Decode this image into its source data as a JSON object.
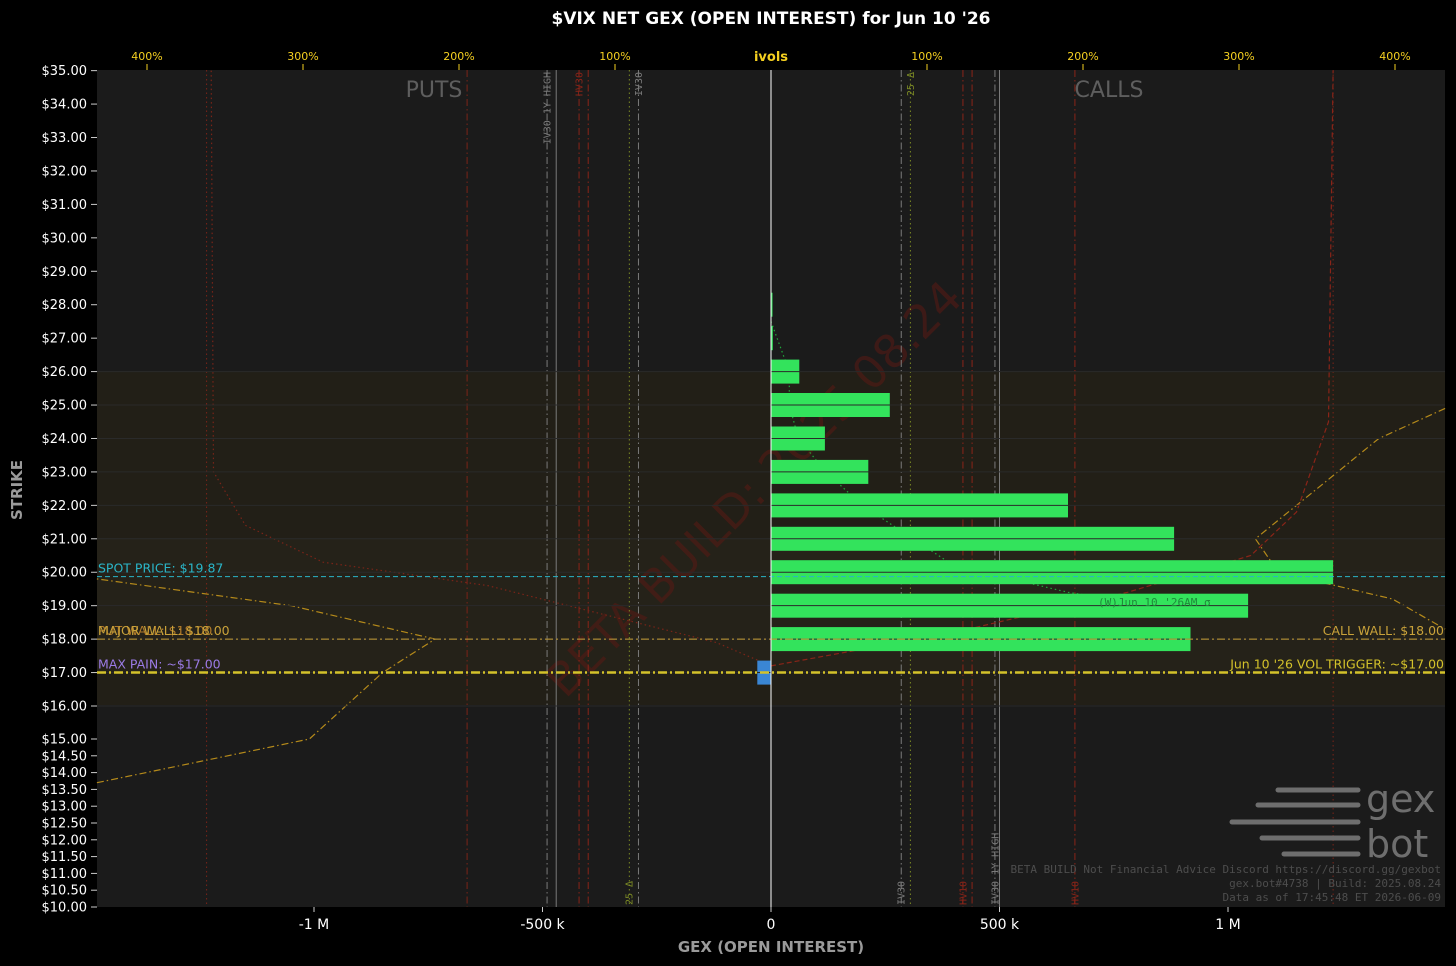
{
  "chart_data": {
    "type": "bar",
    "orientation": "horizontal",
    "title": "$VIX NET GEX (OPEN INTEREST) for Jun 10 '26",
    "xlabel": "GEX (OPEN INTEREST)",
    "ylabel": "STRIKE",
    "x_ticks": [
      {
        "value": -1000000,
        "label": "-1 M"
      },
      {
        "value": -500000,
        "label": "-500 k"
      },
      {
        "value": 0,
        "label": "0"
      },
      {
        "value": 500000,
        "label": "500 k"
      },
      {
        "value": 1000000,
        "label": "1 M"
      }
    ],
    "xlim": [
      -1475000,
      1475000
    ],
    "y_ticks": [
      {
        "value": 35,
        "label": "$35.00"
      },
      {
        "value": 34,
        "label": "$34.00"
      },
      {
        "value": 33,
        "label": "$33.00"
      },
      {
        "value": 32,
        "label": "$32.00"
      },
      {
        "value": 31,
        "label": "$31.00"
      },
      {
        "value": 30,
        "label": "$30.00"
      },
      {
        "value": 29,
        "label": "$29.00"
      },
      {
        "value": 28,
        "label": "$28.00"
      },
      {
        "value": 27,
        "label": "$27.00"
      },
      {
        "value": 26,
        "label": "$26.00"
      },
      {
        "value": 25,
        "label": "$25.00"
      },
      {
        "value": 24,
        "label": "$24.00"
      },
      {
        "value": 23,
        "label": "$23.00"
      },
      {
        "value": 22,
        "label": "$22.00"
      },
      {
        "value": 21,
        "label": "$21.00"
      },
      {
        "value": 20,
        "label": "$20.00"
      },
      {
        "value": 19,
        "label": "$19.00"
      },
      {
        "value": 18,
        "label": "$18.00"
      },
      {
        "value": 17,
        "label": "$17.00"
      },
      {
        "value": 16,
        "label": "$16.00"
      },
      {
        "value": 15,
        "label": "$15.00"
      },
      {
        "value": 14.5,
        "label": "$14.50"
      },
      {
        "value": 14,
        "label": "$14.00"
      },
      {
        "value": 13.5,
        "label": "$13.50"
      },
      {
        "value": 13,
        "label": "$13.00"
      },
      {
        "value": 12.5,
        "label": "$12.50"
      },
      {
        "value": 12,
        "label": "$12.00"
      },
      {
        "value": 11.5,
        "label": "$11.50"
      },
      {
        "value": 11,
        "label": "$11.00"
      },
      {
        "value": 10.5,
        "label": "$10.50"
      },
      {
        "value": 10,
        "label": "$10.00"
      }
    ],
    "ivol_axis": {
      "title": "ivols",
      "ticks": [
        {
          "value": -400,
          "label": "400%"
        },
        {
          "value": -300,
          "label": "300%"
        },
        {
          "value": -200,
          "label": "200%"
        },
        {
          "value": -100,
          "label": "100%"
        },
        {
          "value": 100,
          "label": "100%"
        },
        {
          "value": 200,
          "label": "200%"
        },
        {
          "value": 300,
          "label": "300%"
        },
        {
          "value": 400,
          "label": "400%"
        }
      ]
    },
    "bars": [
      {
        "strike": 28,
        "value": 2000
      },
      {
        "strike": 27,
        "value": 4000
      },
      {
        "strike": 26,
        "value": 62000
      },
      {
        "strike": 25,
        "value": 260000
      },
      {
        "strike": 24,
        "value": 118000
      },
      {
        "strike": 23,
        "value": 213000
      },
      {
        "strike": 22,
        "value": 650000
      },
      {
        "strike": 21,
        "value": 882000
      },
      {
        "strike": 20,
        "value": 1230000
      },
      {
        "strike": 19,
        "value": 1044000
      },
      {
        "strike": 18,
        "value": 918000
      },
      {
        "strike": 17,
        "value": -30000
      }
    ],
    "bar_colors": {
      "positive": "#33e35c",
      "negative": "#3a86d4"
    },
    "side_labels": {
      "puts": "PUTS",
      "calls": "CALLS"
    },
    "levels": [
      {
        "name": "spot",
        "strike": 19.87,
        "label": "SPOT PRICE: $19.87",
        "color": "#2ab5c8",
        "side": "left"
      },
      {
        "name": "put-wall",
        "strike": 18,
        "label": "PUT WALL: $18.00",
        "color": "#b07a2a",
        "side": "left"
      },
      {
        "name": "major-wall",
        "strike": 18,
        "label": "MAJOR WALL: $18.00",
        "color": "#c9a23a",
        "side": "left"
      },
      {
        "name": "call-wall",
        "strike": 18,
        "label": "CALL WALL: $18.00",
        "color": "#c9a23a",
        "side": "right"
      },
      {
        "name": "max-pain",
        "strike": 17,
        "label": "MAX PAIN: ~$17.00",
        "color": "#9b7be6",
        "side": "left"
      },
      {
        "name": "vol-trigger",
        "strike": 17,
        "label": "Jun 10 '26 VOL TRIGGER: ~$17.00",
        "color": "#d4c22a",
        "side": "right"
      }
    ],
    "vertical_markers": [
      {
        "x": -1235000,
        "color": "#7a2418",
        "style": "dotted"
      },
      {
        "x": -665000,
        "color": "#7a2418",
        "style": "dashdot"
      },
      {
        "x": -490000,
        "label": "IV30 1Y HIGH",
        "color": "#7a7a7a",
        "style": "dashdot",
        "label_pos": "top"
      },
      {
        "x": -470000,
        "color": "#7a7a7a",
        "style": "solid"
      },
      {
        "x": -420000,
        "label": "HV30",
        "color": "#8a2418",
        "style": "dashdot",
        "label_pos": "top"
      },
      {
        "x": -400000,
        "color": "#8a2418",
        "style": "dashdot"
      },
      {
        "x": -310000,
        "label": "25 Δ",
        "color": "#7b8a24",
        "style": "dotted",
        "label_pos": "bottom"
      },
      {
        "x": -290000,
        "label": "IV30",
        "color": "#7a7a7a",
        "style": "dashdot",
        "label_pos": "top"
      },
      {
        "x": 285000,
        "label": "IV30",
        "color": "#7a7a7a",
        "style": "dashdot",
        "label_pos": "bottom"
      },
      {
        "x": 305000,
        "label": "25 Δ",
        "color": "#7b8a24",
        "style": "dotted",
        "label_pos": "top"
      },
      {
        "x": 420000,
        "label": "HV10",
        "color": "#8a2418",
        "style": "dashdot",
        "label_pos": "bottom"
      },
      {
        "x": 440000,
        "color": "#8a2418",
        "style": "dashdot"
      },
      {
        "x": 490000,
        "label": "IV30 1Y HIGH",
        "color": "#7a7a7a",
        "style": "dashdot",
        "label_pos": "bottom"
      },
      {
        "x": 500000,
        "color": "#7a7a7a",
        "style": "solid"
      },
      {
        "x": 665000,
        "label": "HV10",
        "color": "#8a2418",
        "style": "dashdot",
        "label_pos": "bottom"
      },
      {
        "x": 1230000,
        "color": "#7a2418",
        "style": "dotted"
      }
    ],
    "ivol_curves": [
      {
        "name": "put-iv",
        "color": "#b58a1a",
        "style": "dashdot",
        "points": [
          [
            -1475000,
            13.7
          ],
          [
            -1010000,
            15
          ],
          [
            -850000,
            17
          ],
          [
            -735000,
            18
          ],
          [
            -1050000,
            19
          ],
          [
            -1475000,
            19.8
          ]
        ]
      },
      {
        "name": "call-iv",
        "color": "#b58a1a",
        "style": "dashdot",
        "points": [
          [
            1475000,
            24.9
          ],
          [
            1330000,
            24
          ],
          [
            1060000,
            21
          ],
          [
            1110000,
            20
          ],
          [
            1360000,
            19.2
          ],
          [
            1475000,
            18.3
          ]
        ]
      },
      {
        "name": "put-hv",
        "color": "#7a2418",
        "style": "dotted",
        "points": [
          [
            -1225000,
            35
          ],
          [
            -1220000,
            23
          ],
          [
            -1150000,
            21.4
          ],
          [
            -980000,
            20.3
          ],
          [
            -620000,
            19.6
          ],
          [
            -120000,
            17.9
          ],
          [
            0,
            17.2
          ]
        ]
      },
      {
        "name": "call-hv",
        "color": "#8a2418",
        "style": "dashed",
        "points": [
          [
            0,
            17.2
          ],
          [
            400000,
            18.2
          ],
          [
            780000,
            19.4
          ],
          [
            1050000,
            20.5
          ],
          [
            1150000,
            21.8
          ],
          [
            1220000,
            24.5
          ],
          [
            1230000,
            35
          ]
        ]
      },
      {
        "name": "oi-trace",
        "color": "#1fa83a",
        "style": "dotted",
        "points": [
          [
            0,
            27.5
          ],
          [
            40000,
            26
          ],
          [
            40000,
            25
          ],
          [
            60000,
            24
          ],
          [
            120000,
            23
          ],
          [
            200000,
            22
          ],
          [
            400000,
            20.2
          ],
          [
            650000,
            19.4
          ],
          [
            980000,
            18.7
          ]
        ]
      }
    ],
    "expiry_label": "(W)Jun 10 '26AM σ",
    "watermark": "BETA BUILD: 2025.08.24",
    "logo": {
      "top": "gex",
      "bottom": "bot"
    },
    "footer": [
      "BETA BUILD Not Financial Advice Discord https://discord.gg/gexbot",
      "gex.bot#4738 | Build: 2025.08.24",
      "Data as of 17:45:48 ET 2026-06-09"
    ]
  }
}
